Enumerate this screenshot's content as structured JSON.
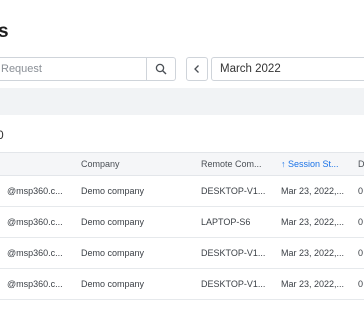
{
  "page": {
    "title": "s"
  },
  "search": {
    "placeholder": "Request"
  },
  "date_filter": {
    "value": "March 2022"
  },
  "session_count": "0",
  "table": {
    "headers": [
      "Company",
      "Remote Com...",
      "↑ Session St...",
      "D"
    ],
    "rows": [
      {
        "user": "@msp360.c...",
        "company": "Demo company",
        "computer": "DESKTOP-V1...",
        "start": "Mar 23, 2022,...",
        "d": "0"
      },
      {
        "user": "@msp360.c...",
        "company": "Demo company",
        "computer": "LAPTOP-S6",
        "start": "Mar 23, 2022,...",
        "d": "0"
      },
      {
        "user": "@msp360.c...",
        "company": "Demo company",
        "computer": "DESKTOP-V1...",
        "start": "Mar 23, 2022,...",
        "d": "0"
      },
      {
        "user": "@msp360.c...",
        "company": "Demo company",
        "computer": "DESKTOP-V1...",
        "start": "Mar 23, 2022,...",
        "d": "0"
      }
    ]
  },
  "icons": {
    "search": "search-icon",
    "prev": "chevron-left-icon"
  },
  "colors": {
    "accent": "#1a73e8",
    "band": "#f1f3f5"
  }
}
